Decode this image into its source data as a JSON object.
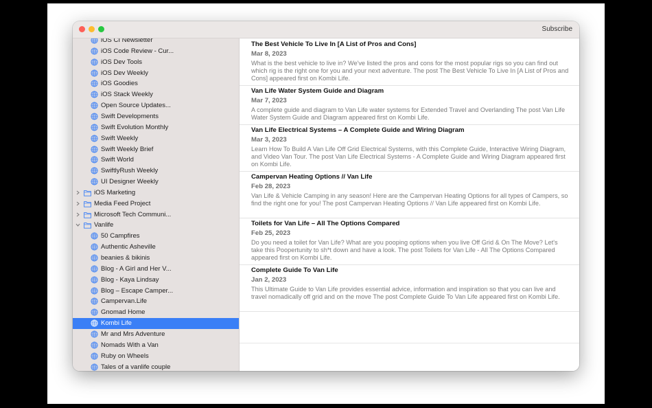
{
  "toolbar": {
    "subscribe_label": "Subscribe"
  },
  "sidebar": {
    "rows": [
      {
        "label": "iOS CI Newsletter",
        "kind": "feed",
        "icon": "globe-icon"
      },
      {
        "label": "iOS Code Review - Cur...",
        "kind": "feed",
        "icon": "globe-icon"
      },
      {
        "label": "iOS Dev Tools",
        "kind": "feed",
        "icon": "globe-icon"
      },
      {
        "label": "iOS Dev Weekly",
        "kind": "feed",
        "icon": "globe-icon"
      },
      {
        "label": "iOS Goodies",
        "kind": "feed",
        "icon": "globe-icon"
      },
      {
        "label": "iOS Stack Weekly",
        "kind": "feed",
        "icon": "globe-icon"
      },
      {
        "label": "Open Source Updates...",
        "kind": "feed",
        "icon": "globe-icon"
      },
      {
        "label": "Swift Developments",
        "kind": "feed",
        "icon": "globe-icon"
      },
      {
        "label": "Swift Evolution Monthly",
        "kind": "feed",
        "icon": "globe-icon"
      },
      {
        "label": "Swift Weekly",
        "kind": "feed",
        "icon": "globe-icon"
      },
      {
        "label": "Swift Weekly Brief",
        "kind": "feed",
        "icon": "globe-icon"
      },
      {
        "label": "Swift World",
        "kind": "feed",
        "icon": "globe-icon"
      },
      {
        "label": "SwiftlyRush Weekly",
        "kind": "feed",
        "icon": "globe-icon"
      },
      {
        "label": "UI Designer Weekly",
        "kind": "feed",
        "icon": "globe-icon"
      },
      {
        "label": "iOS Marketing",
        "kind": "folder",
        "expanded": false,
        "icon": "folder-icon"
      },
      {
        "label": "Media Feed Project",
        "kind": "folder",
        "expanded": false,
        "icon": "folder-icon"
      },
      {
        "label": "Microsoft Tech Communi...",
        "kind": "folder",
        "expanded": false,
        "icon": "folder-icon"
      },
      {
        "label": "Vanlife",
        "kind": "folder",
        "expanded": true,
        "icon": "folder-icon"
      },
      {
        "label": "50 Campfires",
        "kind": "feed",
        "icon": "globe-icon"
      },
      {
        "label": "Authentic Asheville",
        "kind": "feed",
        "icon": "globe-icon"
      },
      {
        "label": "beanies & bikinis",
        "kind": "feed",
        "icon": "globe-icon"
      },
      {
        "label": "Blog - A Girl and Her V...",
        "kind": "feed",
        "icon": "globe-icon"
      },
      {
        "label": "Blog - Kaya Lindsay",
        "kind": "feed",
        "icon": "globe-icon"
      },
      {
        "label": "Blog – Escape Camper...",
        "kind": "feed",
        "icon": "globe-icon"
      },
      {
        "label": "Campervan.Life",
        "kind": "feed",
        "icon": "globe-icon"
      },
      {
        "label": "Gnomad Home",
        "kind": "feed",
        "icon": "globe-icon"
      },
      {
        "label": "Kombi Life",
        "kind": "feed",
        "icon": "globe-icon",
        "selected": true
      },
      {
        "label": "Mr and Mrs Adventure",
        "kind": "feed",
        "icon": "globe-icon"
      },
      {
        "label": "Nomads With a Van",
        "kind": "feed",
        "icon": "globe-icon"
      },
      {
        "label": "Ruby on Wheels",
        "kind": "feed",
        "icon": "globe-icon"
      },
      {
        "label": "Tales of a vanlife couple",
        "kind": "feed",
        "icon": "globe-icon"
      }
    ]
  },
  "articles": [
    {
      "title": "The Best Vehicle To Live In [A List of Pros and Cons]",
      "date": "Mar 8, 2023",
      "summary": "What is the best vehicle to live in? We've listed the pros and cons for the most popular rigs so you can find out which rig is the right one for you and your next adventure. The post The Best Vehicle To Live In [A List of Pros and Cons] appeared first on Kombi Life."
    },
    {
      "title": "Van Life Water System Guide and Diagram",
      "date": "Mar 7, 2023",
      "summary": "A complete guide and diagram to Van Life water systems for Extended Travel and Overlanding The post Van Life Water System Guide and Diagram appeared first on Kombi Life."
    },
    {
      "title": "Van Life Electrical Systems – A Complete Guide and Wiring Diagram",
      "date": "Mar 3, 2023",
      "summary": "Learn How To Build A Van Life Off Grid Electrical Systems, with this Complete Guide, Interactive Wiring Diagram, and Video Van Tour. The post Van Life Electrical Systems - A Complete Guide and Wiring Diagram appeared first on Kombi Life."
    },
    {
      "title": "Campervan Heating Options // Van Life",
      "date": "Feb 28, 2023",
      "summary": "Van Life & Vehicle Camping in any season! Here are the Campervan Heating Options for all types of Campers, so find the right one for you! The post Campervan Heating Options // Van Life appeared first on Kombi Life."
    },
    {
      "title": "Toilets for Van Life – All The Options Compared",
      "date": "Feb 25, 2023",
      "summary": "Do you need a toilet for Van Life? What are you pooping options when you live Off Grid & On The Move? Let's take this Poopertunity to sh*t down and have a look. The post Toilets for Van Life - All The Options Compared appeared first on Kombi Life."
    },
    {
      "title": "Complete Guide To Van Life",
      "date": "Jan 2, 2023",
      "summary": "This Ultimate Guide to Van Life provides essential advice, information and inspiration so that you can live and travel nomadically off grid and on the move The post Complete Guide To Van Life appeared first on Kombi Life."
    }
  ],
  "colors": {
    "selection": "#3a7ff6",
    "sidebar_bg": "#e6e1e0",
    "close": "#fe5f57",
    "minimize": "#febc2e",
    "zoom": "#28c840"
  }
}
